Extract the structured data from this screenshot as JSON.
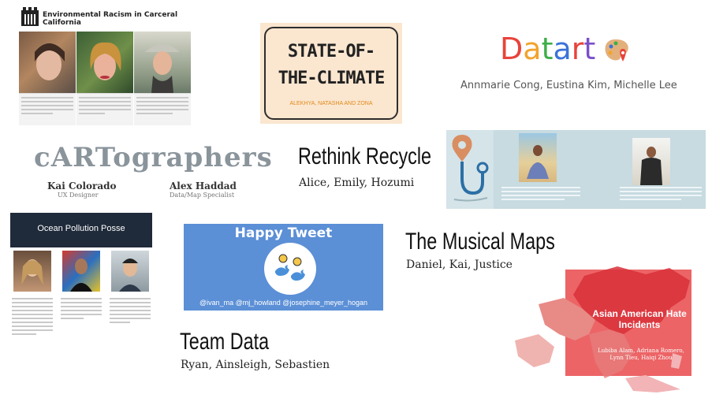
{
  "tiles": {
    "env_racism": {
      "title": "Environmental Racism in Carceral California"
    },
    "state_of_climate": {
      "title_line1": "STATE-OF-",
      "title_line2": "THE-CLIMATE",
      "members": "ALEKHYA, NATASHA AND ZONA"
    },
    "datart": {
      "letters": [
        "D",
        "a",
        "t",
        "a",
        "r",
        "t"
      ],
      "letter_colors": [
        "#e8433b",
        "#f2a32c",
        "#3fae49",
        "#3b73d8",
        "#e8433b",
        "#7a4fc9"
      ],
      "members": "Annmarie Cong, Eustina Kim, Michelle Lee"
    },
    "cartographers": {
      "title": "cARTographers",
      "people": [
        {
          "name": "Kai Colorado",
          "role": "UX Designer"
        },
        {
          "name": "Alex Haddad",
          "role": "Data/Map Specialist"
        }
      ]
    },
    "rethink_recycle": {
      "title": "Rethink Recycle",
      "members": "Alice, Emily, Hozumi"
    },
    "ocean_pollution": {
      "title": "Ocean Pollution Posse"
    },
    "happy_tweet": {
      "title": "Happy Tweet",
      "handles": "@ivan_ma @mj_howland @josephine_meyer_hogan"
    },
    "musical_maps": {
      "title": "The Musical Maps",
      "members": "Daniel, Kai, Justice"
    },
    "team_data": {
      "title": "Team Data",
      "members": "Ryan, Ainsleigh, Sebastien"
    },
    "asian_american": {
      "title": "Asian American Hate Incidents",
      "members": "Lubiba Alam, Adriana Romero, Lynn Tieu, Haiqi Zhou"
    }
  }
}
